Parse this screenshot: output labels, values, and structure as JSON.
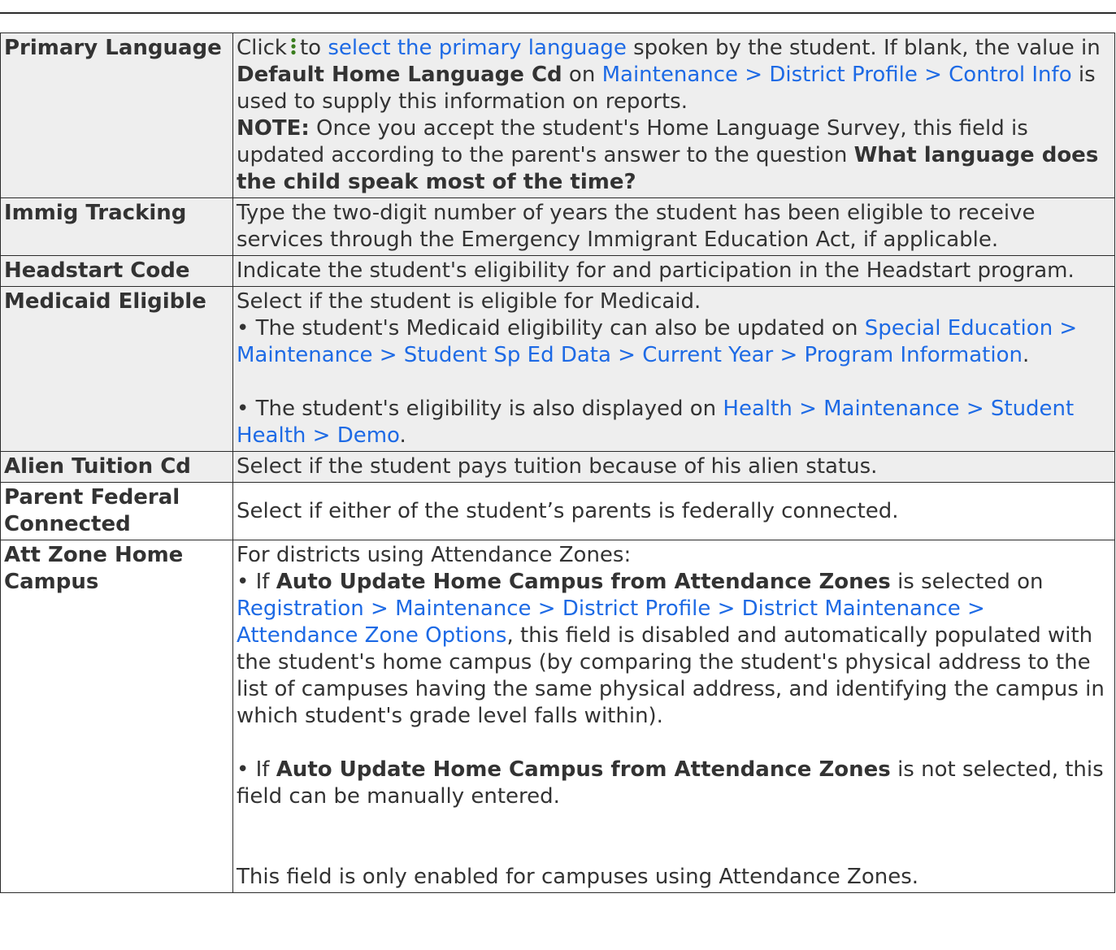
{
  "colors": {
    "link": "#1d6ae5",
    "text": "#333333",
    "shade": "#eeeeee",
    "border": "#2b2b2b",
    "icon": "#3a7d1e"
  },
  "icons": {
    "kebab": "vertical-ellipsis-icon"
  },
  "rows": {
    "primary_language": {
      "label": "Primary Language",
      "t1": "Click",
      "t2": "to",
      "link1": "select the primary language",
      "t3": "spoken by the student. If blank, the value in",
      "b1": "Default Home Language Cd",
      "t4": "on",
      "link2": "Maintenance > District Profile > Control Info",
      "t5": "is used to supply this information on reports.",
      "note_label": "NOTE:",
      "note_text": "Once you accept the student's Home Language Survey, this field is updated according to the parent's answer to the question",
      "note_bold": "What language does the child speak most of the time?"
    },
    "immig_tracking": {
      "label": "Immig Tracking",
      "text": "Type the two-digit number of years the student has been eligible to receive services through the Emergency Immigrant Education Act, if applicable."
    },
    "headstart_code": {
      "label": "Headstart Code",
      "text": "Indicate the student's eligibility for and participation in the Headstart program."
    },
    "medicaid_eligible": {
      "label": "Medicaid Eligible",
      "line1": "Select if the student is eligible for Medicaid.",
      "b1_text": "• The student's Medicaid eligibility can also be updated on",
      "b1_link": "Special Education > Maintenance > Student Sp Ed Data > Current Year > Program Information",
      "b1_end": ".",
      "b2_text": "• The student's eligibility is also displayed on",
      "b2_link": "Health > Maintenance > Student Health > Demo",
      "b2_end": "."
    },
    "alien_tuition": {
      "label": "Alien Tuition Cd",
      "text": "Select if the student pays tuition because of his alien status."
    },
    "parent_federal": {
      "label": "Parent Federal Connected",
      "text": "Select if either of the student’s parents is federally connected."
    },
    "att_zone": {
      "label": "Att Zone Home Campus",
      "intro": "For districts using Attendance Zones:",
      "b1_pre": "• If",
      "b1_bold": "Auto Update Home Campus from Attendance Zones",
      "b1_mid": "is selected on",
      "b1_link": "Registration > Maintenance > District Profile > District Maintenance > Attendance Zone Options",
      "b1_post": ", this field is disabled and automatically populated with the student's home campus (by comparing the student's physical address to the list of campuses having the same physical address, and identifying the campus in which student's grade level falls within).",
      "b2_pre": "• If",
      "b2_bold": "Auto Update Home Campus from Attendance Zones",
      "b2_post": "is not selected, this field can be manually entered.",
      "last": "This field is only enabled for campuses using Attendance Zones."
    }
  }
}
